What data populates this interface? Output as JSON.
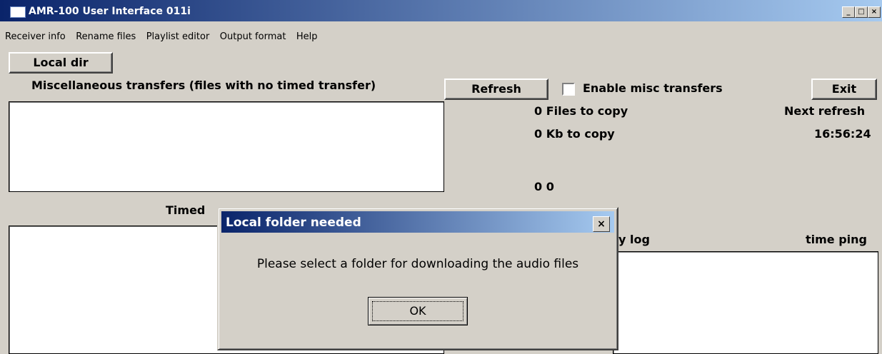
{
  "window": {
    "title": "AMR-100 User Interface 011i",
    "caption_buttons": [
      "_",
      "□",
      "×"
    ]
  },
  "menu": [
    "Receiver info",
    "Rename files",
    "Playlist editor",
    "Output format",
    "Help"
  ],
  "toolbar": {
    "local_dir": "Local dir",
    "refresh": "Refresh",
    "exit": "Exit",
    "enable_misc_label": "Enable misc transfers",
    "enable_misc_checked": false
  },
  "labels": {
    "misc_transfers": "Miscellaneous transfers (files with no timed transfer)",
    "timed": "Timed",
    "files_to_copy": "0 Files to copy",
    "kb_to_copy": "0 Kb to copy",
    "zero_zero": "0 0",
    "next_refresh": "Next refresh",
    "next_refresh_time": "16:56:24",
    "log_partial": "y log",
    "time_ping": "time ping"
  },
  "dialog": {
    "title": "Local folder needed",
    "close": "×",
    "message": "Please select a folder for downloading the audio files",
    "ok": "OK"
  }
}
